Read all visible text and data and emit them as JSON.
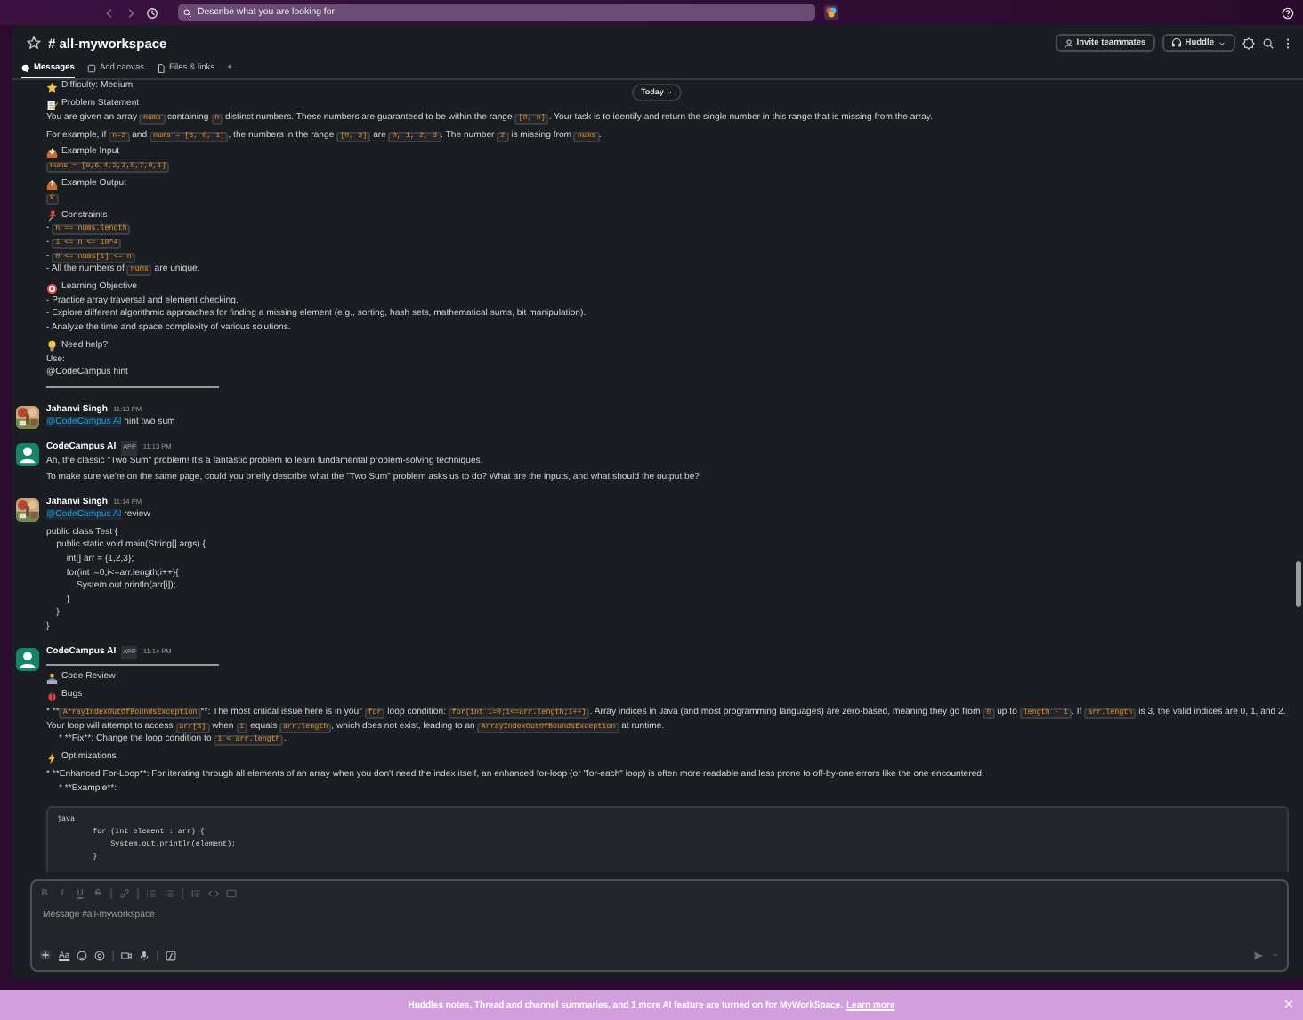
{
  "top_bar": {
    "search": {
      "placeholder": "Describe what you are looking for"
    }
  },
  "channel": {
    "name": "# all-myworkspace",
    "invite_button": "Invite teammates",
    "huddle_button": "Huddle"
  },
  "tabs": [
    {
      "label": "Messages",
      "selected": true
    },
    {
      "label": "Add canvas",
      "selected": false
    },
    {
      "label": "Files & links",
      "selected": false
    },
    {
      "label": "+",
      "selected": false
    }
  ],
  "date_divider": "Today",
  "messages": [
    {
      "kind": "continuation",
      "lines": [
        {
          "kind": "heading",
          "parts": [
            {
              "kind": "text",
              "text": "Difficulty: Medium"
            }
          ]
        },
        {
          "kind": "heading",
          "parts": [
            {
              "kind": "text",
              "text": "Problem Statement"
            }
          ]
        },
        {
          "kind": "line",
          "parts": [
            {
              "kind": "text",
              "text": "You are given an array "
            },
            {
              "kind": "code",
              "text": "nums"
            },
            {
              "kind": "text",
              "text": " containing "
            },
            {
              "kind": "code",
              "text": "n"
            },
            {
              "kind": "text",
              "text": " distinct numbers. These numbers are guaranteed to be within the range "
            },
            {
              "kind": "code",
              "text": "[0, n]"
            },
            {
              "kind": "text",
              "text": ". Your task is to identify and return the single number in this range that is missing from the array."
            }
          ]
        },
        {
          "kind": "para",
          "parts": [
            {
              "kind": "text",
              "text": "For example, if "
            },
            {
              "kind": "code",
              "text": "n=3"
            },
            {
              "kind": "text",
              "text": " and "
            },
            {
              "kind": "code",
              "text": "nums = [3, 0, 1]"
            },
            {
              "kind": "text",
              "text": ", the numbers in the range "
            },
            {
              "kind": "code",
              "text": "[0, 3]"
            },
            {
              "kind": "text",
              "text": " are "
            },
            {
              "kind": "code",
              "text": "0, 1, 2, 3"
            },
            {
              "kind": "text",
              "text": ". The number "
            },
            {
              "kind": "code",
              "text": "2"
            },
            {
              "kind": "text",
              "text": " is missing from "
            },
            {
              "kind": "code",
              "text": "nums"
            },
            {
              "kind": "text",
              "text": "."
            }
          ]
        },
        {
          "kind": "heading",
          "parts": [
            {
              "kind": "text",
              "text": "Example Input"
            }
          ]
        },
        {
          "kind": "line",
          "parts": [
            {
              "kind": "code",
              "text": "nums = [9,6,4,2,3,5,7,0,1]"
            }
          ]
        },
        {
          "kind": "heading",
          "parts": [
            {
              "kind": "text",
              "text": "Example Output"
            }
          ]
        },
        {
          "kind": "line",
          "parts": [
            {
              "kind": "code",
              "text": "8"
            }
          ]
        },
        {
          "kind": "heading",
          "parts": [
            {
              "kind": "text",
              "text": "Constraints"
            }
          ]
        },
        {
          "kind": "line",
          "parts": [
            {
              "kind": "text",
              "text": "- "
            },
            {
              "kind": "code",
              "text": "n == nums.length"
            }
          ]
        },
        {
          "kind": "line",
          "parts": [
            {
              "kind": "text",
              "text": "- "
            },
            {
              "kind": "code",
              "text": "1 <= n <= 10^4"
            }
          ]
        },
        {
          "kind": "line",
          "parts": [
            {
              "kind": "text",
              "text": "- "
            },
            {
              "kind": "code",
              "text": "0 <= nums[i] <= n"
            }
          ]
        },
        {
          "kind": "line",
          "parts": [
            {
              "kind": "text",
              "text": "- All the numbers of "
            },
            {
              "kind": "code",
              "text": "nums"
            },
            {
              "kind": "text",
              "text": " are unique."
            }
          ]
        },
        {
          "kind": "heading",
          "parts": [
            {
              "kind": "text",
              "text": "Learning Objective"
            }
          ]
        },
        {
          "kind": "line",
          "parts": [
            {
              "kind": "text",
              "text": "- Practice array traversal and element checking."
            }
          ]
        },
        {
          "kind": "line",
          "parts": [
            {
              "kind": "text",
              "text": "- Explore different algorithmic approaches for finding a missing element (e.g., sorting, hash sets, mathematical sums, bit manipulation)."
            }
          ]
        },
        {
          "kind": "line",
          "parts": [
            {
              "kind": "text",
              "text": "- Analyze the time and space complexity of various solutions."
            }
          ]
        },
        {
          "kind": "heading",
          "parts": [
            {
              "kind": "text",
              "text": "Need help?"
            }
          ]
        },
        {
          "kind": "line",
          "parts": [
            {
              "kind": "text",
              "text": "Use:"
            }
          ]
        },
        {
          "kind": "line",
          "parts": [
            {
              "kind": "text",
              "text": "@CodeCampus hint"
            }
          ]
        },
        {
          "kind": "rule"
        }
      ]
    },
    {
      "kind": "message",
      "avatar": {
        "kind": "picture"
      },
      "author": "Jahanvi Singh",
      "time": "11:13 PM",
      "lines": [
        {
          "kind": "line",
          "parts": [
            {
              "kind": "mention",
              "text": "@CodeCampus AI"
            },
            {
              "kind": "text",
              "text": " hint two sum"
            }
          ]
        }
      ]
    },
    {
      "kind": "message",
      "avatar": {
        "kind": "icon"
      },
      "author": "CodeCampus AI",
      "badge": "APP",
      "time": "11:13 PM",
      "lines": [
        {
          "kind": "line",
          "parts": [
            {
              "kind": "text",
              "text": "Ah, the classic \"Two Sum\" problem! It's a fantastic problem to learn fundamental problem-solving techniques."
            }
          ]
        },
        {
          "kind": "para",
          "parts": [
            {
              "kind": "text",
              "text": "To make sure we're on the same page, could you briefly describe what the \"Two Sum\" problem asks us to do? What are the inputs, and what should the output be?"
            }
          ]
        }
      ]
    },
    {
      "kind": "message",
      "avatar": {
        "kind": "picture"
      },
      "author": "Jahanvi Singh",
      "time": "11:14 PM",
      "lines": [
        {
          "kind": "line",
          "parts": [
            {
              "kind": "mention",
              "text": "@CodeCampus AI"
            },
            {
              "kind": "text",
              "text": " review"
            }
          ]
        },
        {
          "kind": "pre",
          "lines": [
            "public class Test {",
            "    public static void main(String[] args) {",
            "        int[] arr = {1,2,3};",
            "        for(int i=0;i<=arr.length;i++){",
            "            System.out.println(arr[i]);",
            "        }",
            "    }",
            "}"
          ]
        }
      ]
    },
    {
      "kind": "message",
      "avatar": {
        "kind": "icon"
      },
      "author": "CodeCampus AI",
      "badge": "APP",
      "time": "11:14 PM",
      "lines": [
        {
          "kind": "rule"
        },
        {
          "kind": "heading",
          "parts": [
            {
              "kind": "text",
              "text": "Code Review"
            }
          ]
        },
        {
          "kind": "heading",
          "parts": [
            {
              "kind": "text",
              "text": "Bugs"
            }
          ]
        },
        {
          "kind": "para",
          "parts": [
            {
              "kind": "text",
              "text": "*  **"
            },
            {
              "kind": "code",
              "text": "ArrayIndexOutOfBoundsException"
            },
            {
              "kind": "text",
              "text": "**: The most critical issue here is in your "
            },
            {
              "kind": "code",
              "text": "for"
            },
            {
              "kind": "text",
              "text": " loop condition: "
            },
            {
              "kind": "code",
              "text": "for(int i=0;i<=arr.length;i++)"
            },
            {
              "kind": "text",
              "text": ". Array indices in Java (and most programming languages) are zero-based, meaning they go from "
            },
            {
              "kind": "code",
              "text": "0"
            },
            {
              "kind": "text",
              "text": " up to "
            },
            {
              "kind": "code",
              "text": "length - 1"
            },
            {
              "kind": "text",
              "text": ". If "
            },
            {
              "kind": "code",
              "text": "arr.length"
            },
            {
              "kind": "text",
              "text": " is 3, the valid indices are 0, 1, and 2. Your loop will attempt to access "
            },
            {
              "kind": "code",
              "text": "arr[3]"
            },
            {
              "kind": "text",
              "text": " when "
            },
            {
              "kind": "code",
              "text": "i"
            },
            {
              "kind": "text",
              "text": " equals "
            },
            {
              "kind": "code",
              "text": "arr.length"
            },
            {
              "kind": "text",
              "text": ", which does not exist, leading to an "
            },
            {
              "kind": "code",
              "text": "ArrayIndexOutOfBoundsException"
            },
            {
              "kind": "text",
              "text": " at runtime."
            }
          ]
        },
        {
          "kind": "sub",
          "parts": [
            {
              "kind": "text",
              "text": "*  **Fix**: Change the loop condition to "
            },
            {
              "kind": "code",
              "text": "i < arr.length"
            },
            {
              "kind": "text",
              "text": "."
            }
          ]
        },
        {
          "kind": "heading",
          "parts": [
            {
              "kind": "text",
              "text": "Optimizations"
            }
          ]
        },
        {
          "kind": "para",
          "parts": [
            {
              "kind": "text",
              "text": "*  **Enhanced For-Loop**: For iterating through all elements of an array when you don't need the index itself, an enhanced for-loop (or \"for-each\" loop) is often more readable and less prone to off-by-one errors like the one encountered."
            }
          ]
        },
        {
          "kind": "sub",
          "parts": [
            {
              "kind": "text",
              "text": "*  **Example**:"
            }
          ]
        },
        {
          "kind": "codeblock",
          "lines": [
            "java",
            "        for (int element : arr) {",
            "            System.out.println(element);",
            "        }"
          ]
        }
      ]
    }
  ],
  "composer": {
    "format_buttons": [
      "B",
      "I",
      "U",
      "S"
    ],
    "placeholder": "Message #all-myworkspace",
    "text_button": "Aa"
  },
  "banner": {
    "text": "Huddles notes, Thread and channel summaries, and 1 more AI feature are turned on for MyWorkSpace.",
    "link": "Learn more"
  }
}
